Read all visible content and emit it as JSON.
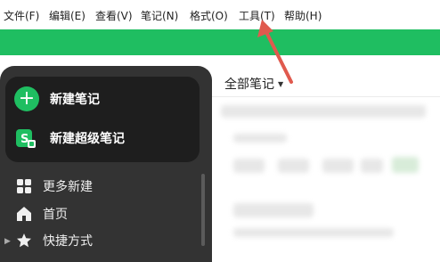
{
  "menu": {
    "items": [
      {
        "label": "文件(F)"
      },
      {
        "label": "编辑(E)"
      },
      {
        "label": "查看(V)"
      },
      {
        "label": "笔记(N)"
      },
      {
        "label": "格式(O)"
      },
      {
        "label": "工具(T)"
      },
      {
        "label": "帮助(H)"
      }
    ]
  },
  "toolbar": {
    "accent_color": "#1fbe61"
  },
  "sidebar": {
    "new_note_label": "新建笔记",
    "new_super_note_label": "新建超级笔记",
    "nav": [
      {
        "label": "更多新建",
        "icon": "grid-icon"
      },
      {
        "label": "首页",
        "icon": "home-icon"
      },
      {
        "label": "快捷方式",
        "icon": "star-icon"
      }
    ]
  },
  "main": {
    "filter_label": "全部笔记"
  },
  "annotation": {
    "color": "#e05a4e"
  }
}
